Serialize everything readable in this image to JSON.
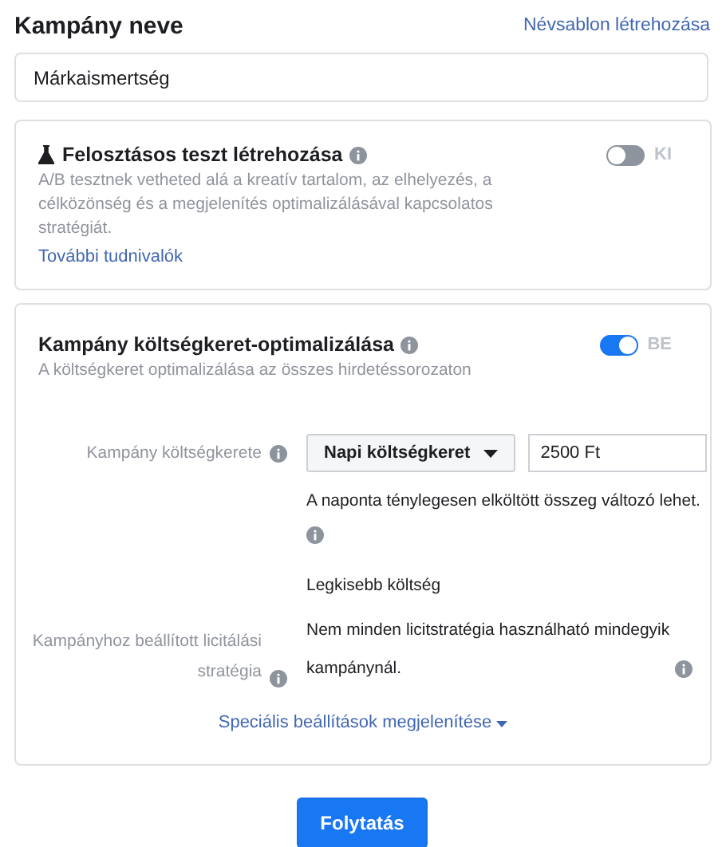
{
  "header": {
    "title": "Kampány neve",
    "link": "Névsablon létrehozása"
  },
  "name_field": {
    "value": "Márkaismertség"
  },
  "split_test": {
    "title": "Felosztásos teszt létrehozása",
    "description": "A/B tesztnek vetheted alá a kreatív tartalom, az elhelyezés, a célközönség és a megjelenítés optimalizálásával kapcsolatos stratégiát.",
    "link": "További tudnivalók",
    "toggle": {
      "on": false,
      "label": "KI"
    }
  },
  "budget_optimization": {
    "title": "Kampány költségkeret-optimalizálása",
    "description": "A költségkeret optimalizálása az összes hirdetéssorozaton",
    "toggle": {
      "on": true,
      "label": "BE"
    },
    "budget": {
      "label": "Kampány költségkerete",
      "dropdown": "Napi költségkeret",
      "amount": "2500 Ft",
      "note": "A naponta ténylegesen elköltött összeg változó lehet."
    },
    "bid_strategy": {
      "label": "Kampányhoz beállított licitálási stratégia",
      "value": "Legkisebb költség",
      "note": "Nem minden licitstratégia használható mindegyik kampánynál."
    },
    "advanced_link": "Speciális beállítások megjelenítése"
  },
  "continue_button": "Folytatás"
}
